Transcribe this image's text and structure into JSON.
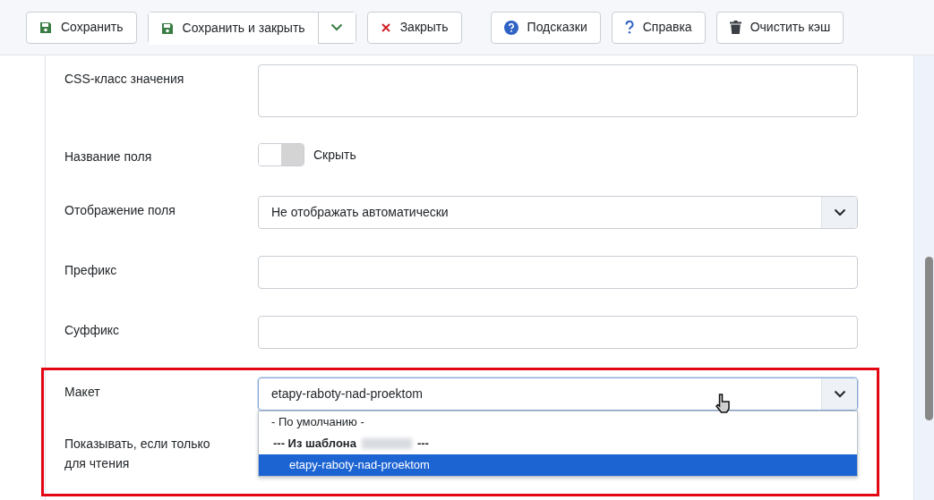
{
  "toolbar": [
    {
      "kind": "save",
      "label": "Сохранить"
    },
    {
      "kind": "save-split",
      "label": "Сохранить и закрыть"
    },
    {
      "kind": "close",
      "label": "Закрыть"
    },
    {
      "kind": "hints",
      "label": "Подсказки"
    },
    {
      "kind": "help",
      "label": "Справка"
    },
    {
      "kind": "trash",
      "label": "Очистить кэш"
    }
  ],
  "fields": [
    {
      "kind": "textarea",
      "label": "CSS-класс значения"
    },
    {
      "kind": "toggle",
      "label": "Название поля",
      "on": false,
      "option": "Скрыть"
    },
    {
      "kind": "select",
      "label": "Отображение поля",
      "value": "Не отображать автоматически"
    },
    {
      "kind": "text",
      "label": "Префикс"
    },
    {
      "kind": "text",
      "label": "Суффикс"
    }
  ],
  "highlighted": {
    "label": "Макет",
    "value": "etapy-raboty-nad-proektom",
    "expanded": true,
    "options": [
      {
        "kind": "option",
        "label": "- По умолчанию -",
        "selected": false
      },
      {
        "kind": "group",
        "label_start": "--- Из шаблона",
        "label_end": "---"
      },
      {
        "kind": "option",
        "label": "etapy-raboty-nad-proektom",
        "selected": true
      }
    ],
    "next_label": "Показывать, если только для чтения"
  }
}
